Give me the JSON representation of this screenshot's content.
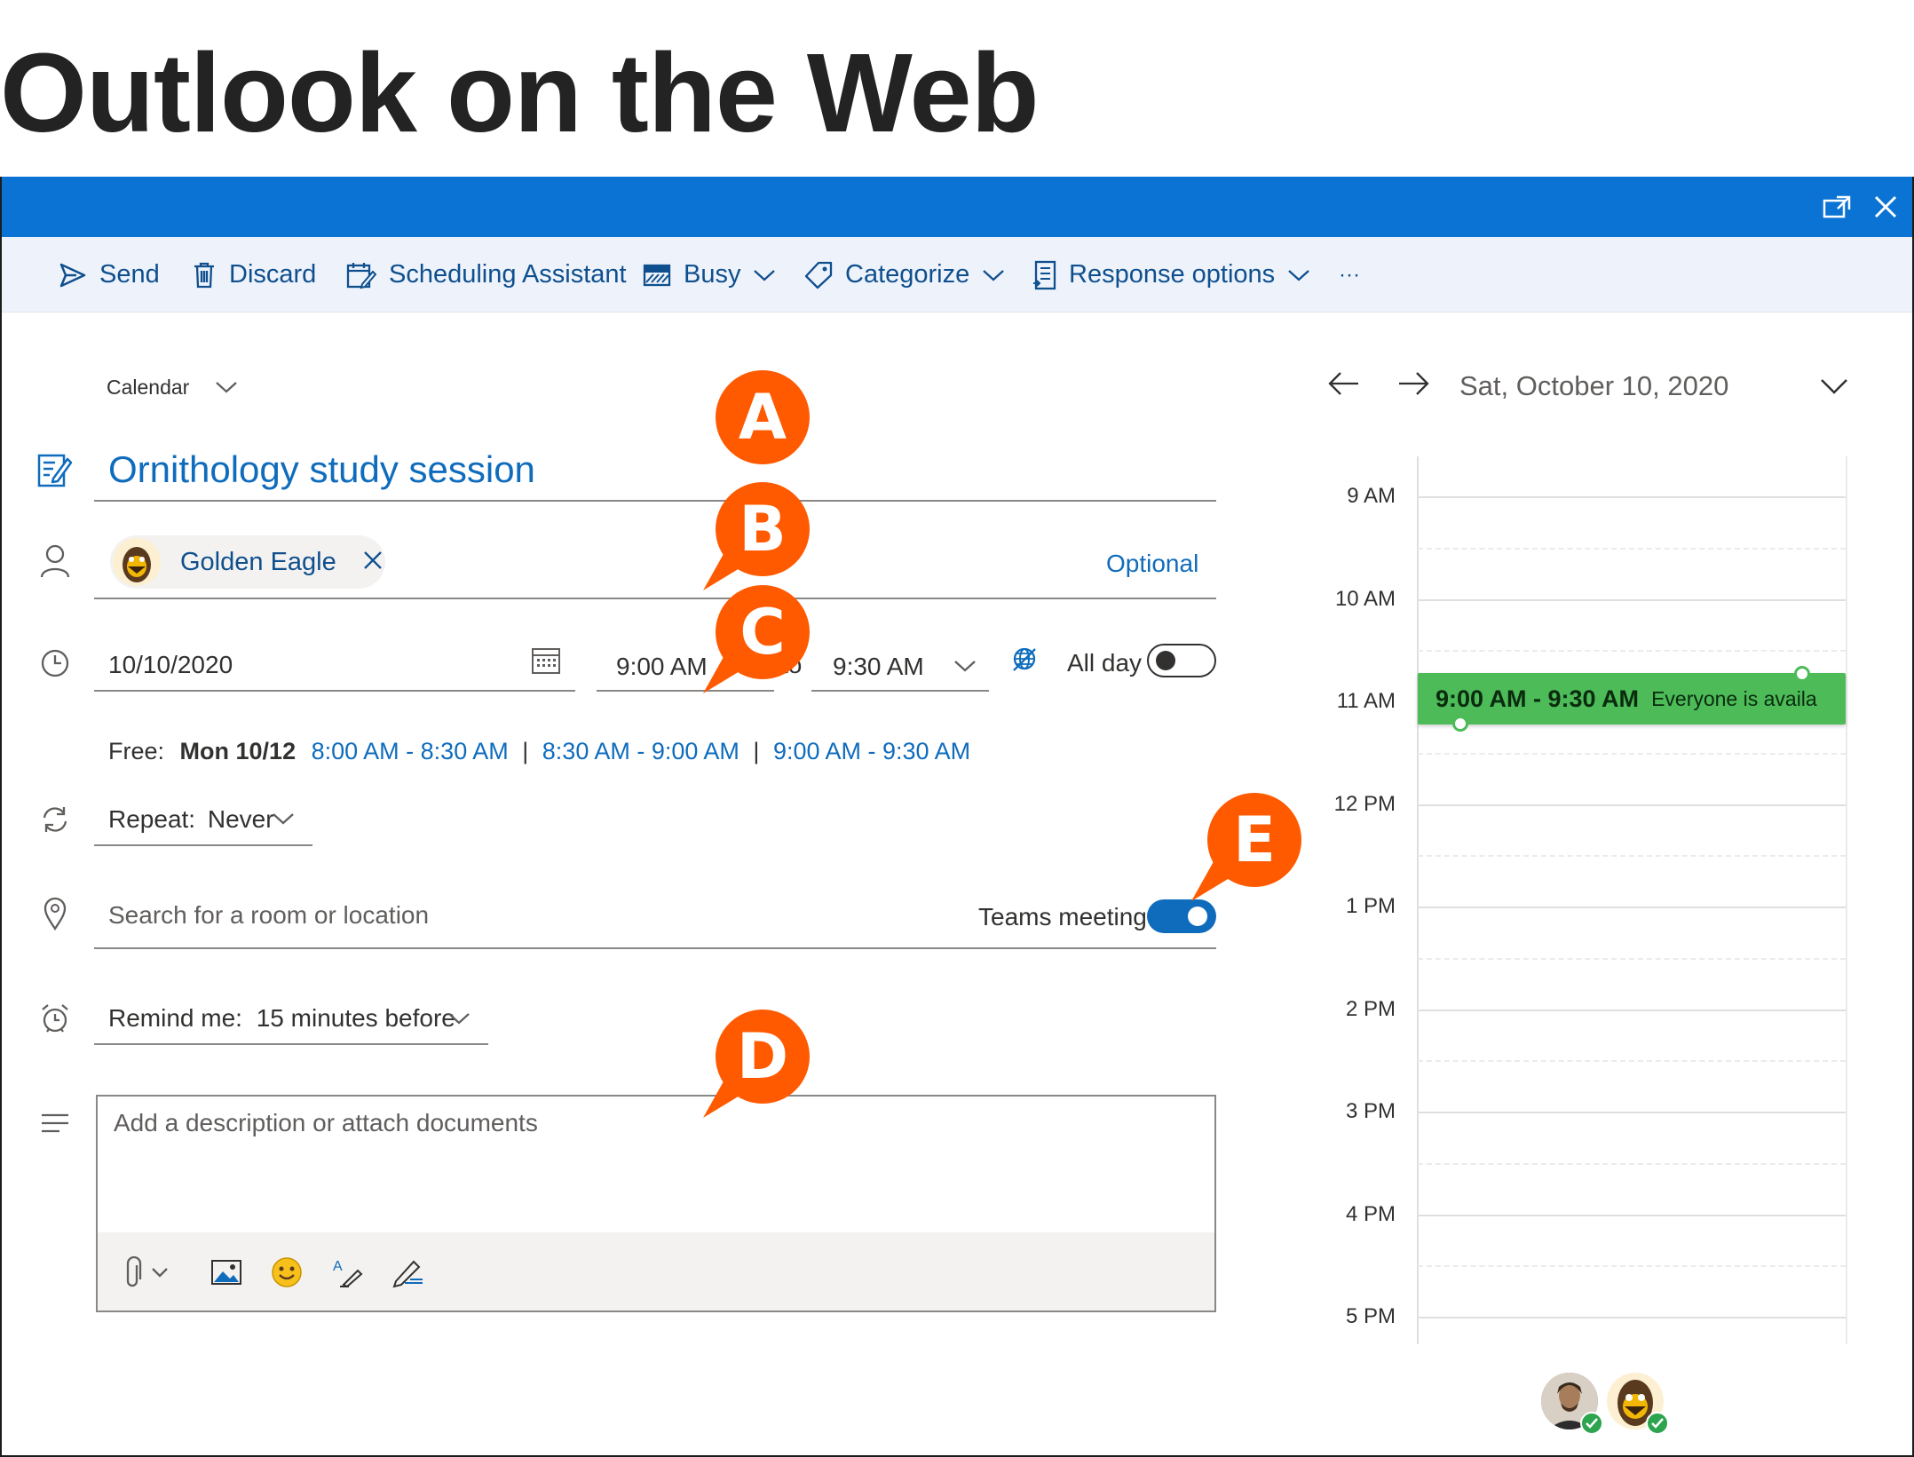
{
  "page": {
    "heading": "Outlook on the Web"
  },
  "toolbar": {
    "send": "Send",
    "discard": "Discard",
    "scheduling": "Scheduling Assistant",
    "busy": "Busy",
    "categorize": "Categorize",
    "response": "Response options",
    "more": "···"
  },
  "form": {
    "calendar_label": "Calendar",
    "title": "Ornithology study session",
    "attendee": {
      "name": "Golden Eagle"
    },
    "optional_label": "Optional",
    "date": "10/10/2020",
    "start_time": "9:00 AM",
    "to_label": "to",
    "end_time": "9:30 AM",
    "all_day_label": "All day",
    "all_day_on": false,
    "free": {
      "label": "Free:",
      "day": "Mon 10/12",
      "slots": [
        "8:00 AM - 8:30 AM",
        "8:30 AM - 9:00 AM",
        "9:00 AM - 9:30 AM"
      ],
      "separator": "|"
    },
    "repeat_label": "Repeat:",
    "repeat_value": "Never",
    "location_placeholder": "Search for a room or location",
    "teams_label": "Teams meeting",
    "teams_on": true,
    "remind_label": "Remind me:",
    "remind_value": "15 minutes before",
    "description_placeholder": "Add a description or attach documents"
  },
  "callouts": {
    "a": "A",
    "b": "B",
    "c": "C",
    "d": "D",
    "e": "E"
  },
  "calendar": {
    "date_label": "Sat, October 10, 2020",
    "hours": [
      "9 AM",
      "10 AM",
      "11 AM",
      "12 PM",
      "1 PM",
      "2 PM",
      "3 PM",
      "4 PM",
      "5 PM"
    ],
    "event": {
      "time": "9:00 AM - 9:30 AM",
      "status": "Everyone is availa"
    }
  },
  "colors": {
    "title_bar": "#0a73d4",
    "accent": "#0f6cbd",
    "callout": "#ff5a00",
    "event": "#4cbb58"
  }
}
